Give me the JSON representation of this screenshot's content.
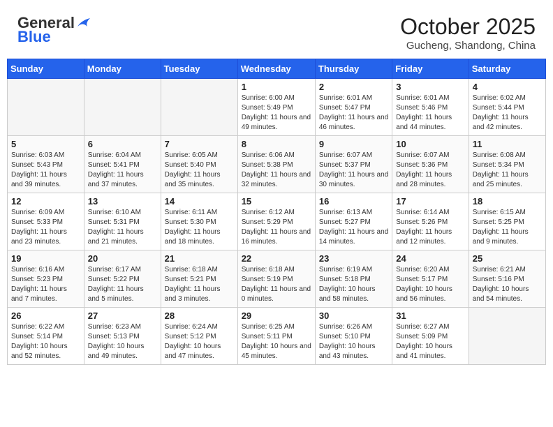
{
  "header": {
    "logo_general": "General",
    "logo_blue": "Blue",
    "month": "October 2025",
    "location": "Gucheng, Shandong, China"
  },
  "weekdays": [
    "Sunday",
    "Monday",
    "Tuesday",
    "Wednesday",
    "Thursday",
    "Friday",
    "Saturday"
  ],
  "weeks": [
    [
      {
        "day": "",
        "empty": true
      },
      {
        "day": "",
        "empty": true
      },
      {
        "day": "",
        "empty": true
      },
      {
        "day": "1",
        "sunrise": "6:00 AM",
        "sunset": "5:49 PM",
        "daylight": "11 hours and 49 minutes."
      },
      {
        "day": "2",
        "sunrise": "6:01 AM",
        "sunset": "5:47 PM",
        "daylight": "11 hours and 46 minutes."
      },
      {
        "day": "3",
        "sunrise": "6:01 AM",
        "sunset": "5:46 PM",
        "daylight": "11 hours and 44 minutes."
      },
      {
        "day": "4",
        "sunrise": "6:02 AM",
        "sunset": "5:44 PM",
        "daylight": "11 hours and 42 minutes."
      }
    ],
    [
      {
        "day": "5",
        "sunrise": "6:03 AM",
        "sunset": "5:43 PM",
        "daylight": "11 hours and 39 minutes."
      },
      {
        "day": "6",
        "sunrise": "6:04 AM",
        "sunset": "5:41 PM",
        "daylight": "11 hours and 37 minutes."
      },
      {
        "day": "7",
        "sunrise": "6:05 AM",
        "sunset": "5:40 PM",
        "daylight": "11 hours and 35 minutes."
      },
      {
        "day": "8",
        "sunrise": "6:06 AM",
        "sunset": "5:38 PM",
        "daylight": "11 hours and 32 minutes."
      },
      {
        "day": "9",
        "sunrise": "6:07 AM",
        "sunset": "5:37 PM",
        "daylight": "11 hours and 30 minutes."
      },
      {
        "day": "10",
        "sunrise": "6:07 AM",
        "sunset": "5:36 PM",
        "daylight": "11 hours and 28 minutes."
      },
      {
        "day": "11",
        "sunrise": "6:08 AM",
        "sunset": "5:34 PM",
        "daylight": "11 hours and 25 minutes."
      }
    ],
    [
      {
        "day": "12",
        "sunrise": "6:09 AM",
        "sunset": "5:33 PM",
        "daylight": "11 hours and 23 minutes."
      },
      {
        "day": "13",
        "sunrise": "6:10 AM",
        "sunset": "5:31 PM",
        "daylight": "11 hours and 21 minutes."
      },
      {
        "day": "14",
        "sunrise": "6:11 AM",
        "sunset": "5:30 PM",
        "daylight": "11 hours and 18 minutes."
      },
      {
        "day": "15",
        "sunrise": "6:12 AM",
        "sunset": "5:29 PM",
        "daylight": "11 hours and 16 minutes."
      },
      {
        "day": "16",
        "sunrise": "6:13 AM",
        "sunset": "5:27 PM",
        "daylight": "11 hours and 14 minutes."
      },
      {
        "day": "17",
        "sunrise": "6:14 AM",
        "sunset": "5:26 PM",
        "daylight": "11 hours and 12 minutes."
      },
      {
        "day": "18",
        "sunrise": "6:15 AM",
        "sunset": "5:25 PM",
        "daylight": "11 hours and 9 minutes."
      }
    ],
    [
      {
        "day": "19",
        "sunrise": "6:16 AM",
        "sunset": "5:23 PM",
        "daylight": "11 hours and 7 minutes."
      },
      {
        "day": "20",
        "sunrise": "6:17 AM",
        "sunset": "5:22 PM",
        "daylight": "11 hours and 5 minutes."
      },
      {
        "day": "21",
        "sunrise": "6:18 AM",
        "sunset": "5:21 PM",
        "daylight": "11 hours and 3 minutes."
      },
      {
        "day": "22",
        "sunrise": "6:18 AM",
        "sunset": "5:19 PM",
        "daylight": "11 hours and 0 minutes."
      },
      {
        "day": "23",
        "sunrise": "6:19 AM",
        "sunset": "5:18 PM",
        "daylight": "10 hours and 58 minutes."
      },
      {
        "day": "24",
        "sunrise": "6:20 AM",
        "sunset": "5:17 PM",
        "daylight": "10 hours and 56 minutes."
      },
      {
        "day": "25",
        "sunrise": "6:21 AM",
        "sunset": "5:16 PM",
        "daylight": "10 hours and 54 minutes."
      }
    ],
    [
      {
        "day": "26",
        "sunrise": "6:22 AM",
        "sunset": "5:14 PM",
        "daylight": "10 hours and 52 minutes."
      },
      {
        "day": "27",
        "sunrise": "6:23 AM",
        "sunset": "5:13 PM",
        "daylight": "10 hours and 49 minutes."
      },
      {
        "day": "28",
        "sunrise": "6:24 AM",
        "sunset": "5:12 PM",
        "daylight": "10 hours and 47 minutes."
      },
      {
        "day": "29",
        "sunrise": "6:25 AM",
        "sunset": "5:11 PM",
        "daylight": "10 hours and 45 minutes."
      },
      {
        "day": "30",
        "sunrise": "6:26 AM",
        "sunset": "5:10 PM",
        "daylight": "10 hours and 43 minutes."
      },
      {
        "day": "31",
        "sunrise": "6:27 AM",
        "sunset": "5:09 PM",
        "daylight": "10 hours and 41 minutes."
      },
      {
        "day": "",
        "empty": true
      }
    ]
  ]
}
